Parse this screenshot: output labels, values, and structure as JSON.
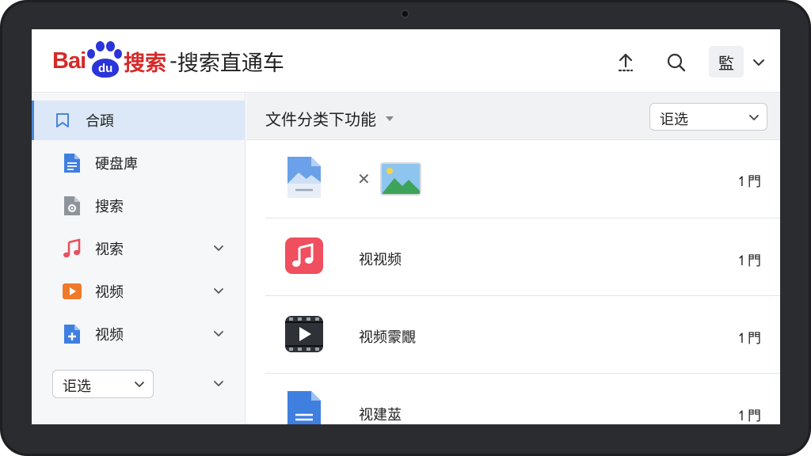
{
  "app": {
    "logo_bai": "Bai",
    "logo_du": "du",
    "logo_sousuo": "搜索",
    "title_separator": "-",
    "title": "搜索直通车"
  },
  "header": {
    "upload_icon": "upload-icon",
    "search_icon": "search-icon",
    "avatar_label": "監",
    "menu_icon": "chevron-down-icon"
  },
  "sidebar": {
    "items": [
      {
        "label": "合頙",
        "icon": "bookmark-icon",
        "active": true,
        "expandable": false
      },
      {
        "label": "硬盘庳",
        "icon": "document-icon",
        "active": false,
        "expandable": false
      },
      {
        "label": "搜索",
        "icon": "settings-file-icon",
        "active": false,
        "expandable": false
      },
      {
        "label": "视索",
        "icon": "music-icon",
        "active": false,
        "expandable": true
      },
      {
        "label": "视频",
        "icon": "video-icon",
        "active": false,
        "expandable": true
      },
      {
        "label": "视频",
        "icon": "add-file-icon",
        "active": false,
        "expandable": true
      }
    ],
    "filter_select": {
      "label": "讵选"
    }
  },
  "main": {
    "section_title": "文件分类下功能",
    "filter_select": {
      "label": "讵选"
    },
    "files": [
      {
        "name": "",
        "meta": "↿門",
        "icon": "image-file-icon",
        "has_thumbnail": true
      },
      {
        "name": "视视频",
        "meta": "↿門",
        "icon": "music-app-icon"
      },
      {
        "name": "视频霥覵",
        "meta": "↿門",
        "icon": "video-player-icon"
      },
      {
        "name": "视建莁",
        "meta": "↿門",
        "icon": "document-icon"
      }
    ]
  },
  "colors": {
    "accent": "#4a86d6",
    "brand_red": "#d42a2a",
    "brand_blue": "#2b34d8",
    "active_bg": "#dce8f7"
  }
}
